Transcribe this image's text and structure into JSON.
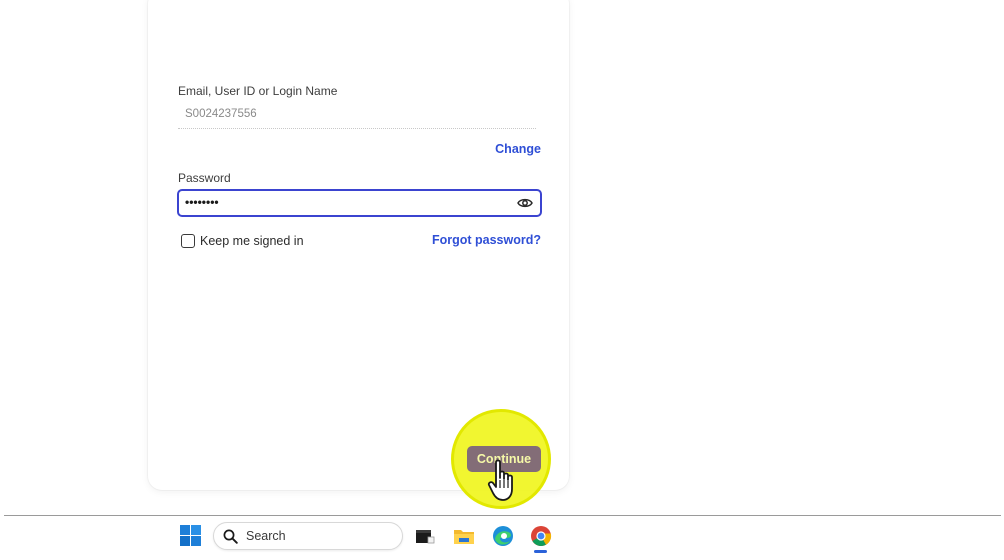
{
  "login": {
    "email_label": "Email, User ID or Login Name",
    "email_value": "S0024237556",
    "change_link": "Change",
    "password_label": "Password",
    "password_value": "••••••••",
    "keep_signed_in_label": "Keep me signed in",
    "keep_signed_in_checked": false,
    "forgot_password_link": "Forgot password?",
    "continue_button": "Continue"
  },
  "taskbar": {
    "search_placeholder": "Search",
    "apps": [
      "start-icon",
      "terminal-icon",
      "file-explorer-icon",
      "edge-browser-icon",
      "chrome-browser-icon"
    ]
  },
  "colors": {
    "accent_link": "#2f4fd6",
    "input_focus_border": "#3b44d0",
    "continue_bg": "#836d77",
    "highlight": "#f0f51e"
  }
}
